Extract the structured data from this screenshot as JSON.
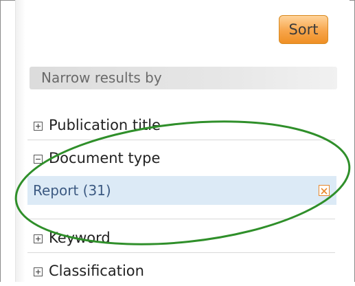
{
  "sort": {
    "label": "Sort"
  },
  "narrow": {
    "header": "Narrow results by"
  },
  "facets": [
    {
      "label": "Publication title",
      "state": "collapsed"
    },
    {
      "label": "Document type",
      "state": "expanded"
    },
    {
      "label": "Keyword",
      "state": "collapsed"
    },
    {
      "label": "Classification",
      "state": "collapsed"
    }
  ],
  "selected_filter": {
    "label": "Report (31)"
  },
  "colors": {
    "sort_button": "#f7a54a",
    "selected_row": "#dceaf6",
    "annotation_ellipse": "#2f8f2a",
    "remove_icon": "#e8872b"
  }
}
